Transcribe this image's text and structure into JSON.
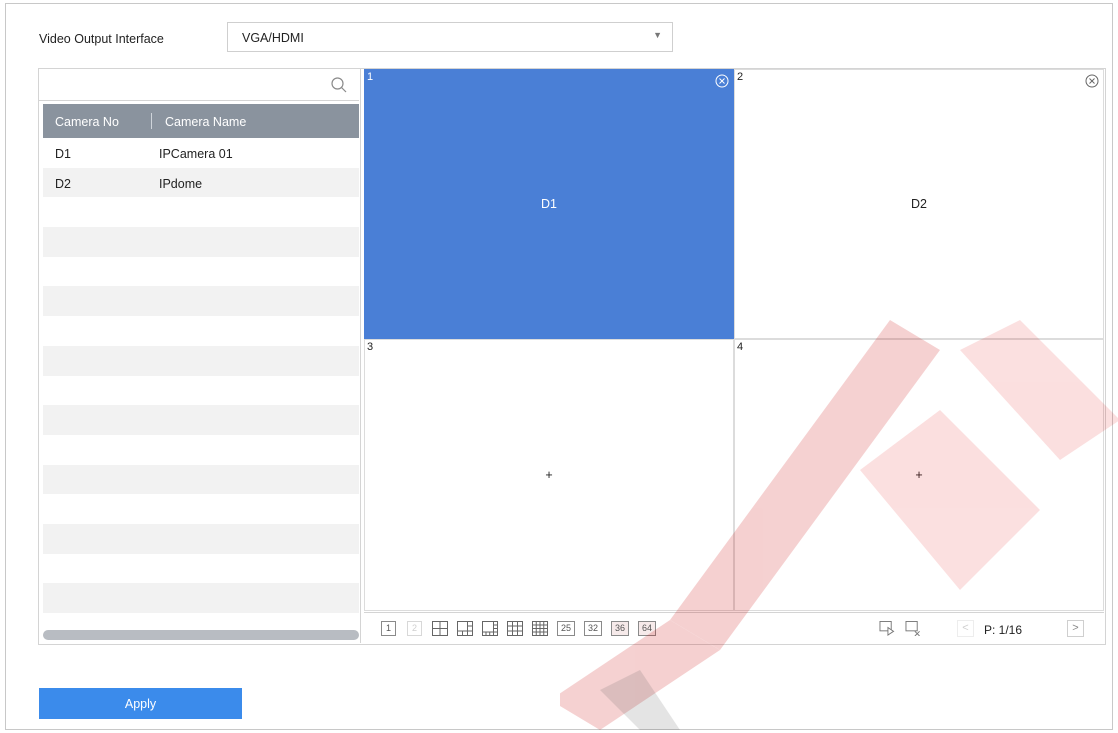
{
  "header": {
    "label": "Video Output Interface",
    "select_value": "VGA/HDMI"
  },
  "camera_list": {
    "columns": [
      "Camera No",
      "Camera Name"
    ],
    "rows": [
      {
        "no": "D1",
        "name": "IPCamera 01"
      },
      {
        "no": "D2",
        "name": "IPdome"
      }
    ]
  },
  "windows": [
    {
      "num": "1",
      "content": "D1",
      "selected": true
    },
    {
      "num": "2",
      "content": "D2",
      "selected": false
    },
    {
      "num": "3",
      "content": "+",
      "selected": false
    },
    {
      "num": "4",
      "content": "+",
      "selected": false
    }
  ],
  "toolbar": {
    "layouts": [
      "1",
      "2",
      "4",
      "6",
      "8",
      "9",
      "16",
      "25",
      "32",
      "36",
      "64"
    ],
    "page": "P: 1/16"
  },
  "apply_label": "Apply",
  "colors": {
    "selected_window": "#4a7fd6",
    "apply_button": "#3b8beb",
    "table_header": "#8a939e"
  }
}
